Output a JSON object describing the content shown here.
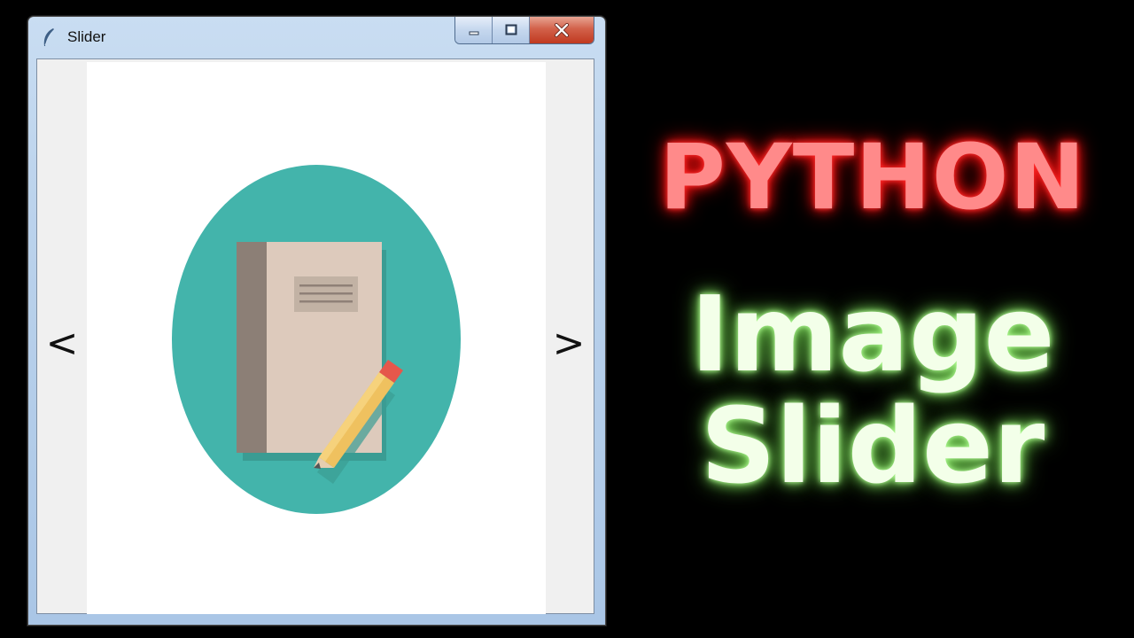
{
  "window": {
    "title": "Slider",
    "app_icon": "feather-icon",
    "controls": {
      "minimize_icon": "minimize-icon",
      "maximize_icon": "maximize-icon",
      "close_icon": "close-icon"
    }
  },
  "slider": {
    "prev_label": "<",
    "next_label": ">",
    "current_image": "notebook-with-pencil-illustration"
  },
  "headline": {
    "line1": "PYTHON",
    "line2": "Image",
    "line3": "Slider"
  },
  "colors": {
    "background": "#000000",
    "python_glow": "#ff2d2d",
    "python_text": "#ff8a8a",
    "image_slider_text": "#f3ffe9",
    "image_slider_glow": "#8fe86e",
    "illustration_circle": "#43b4ab",
    "notebook_cover": "#ddcabc",
    "notebook_spine": "#8c7f76",
    "pencil_body": "#efc15f",
    "pencil_eraser": "#e5574b"
  }
}
